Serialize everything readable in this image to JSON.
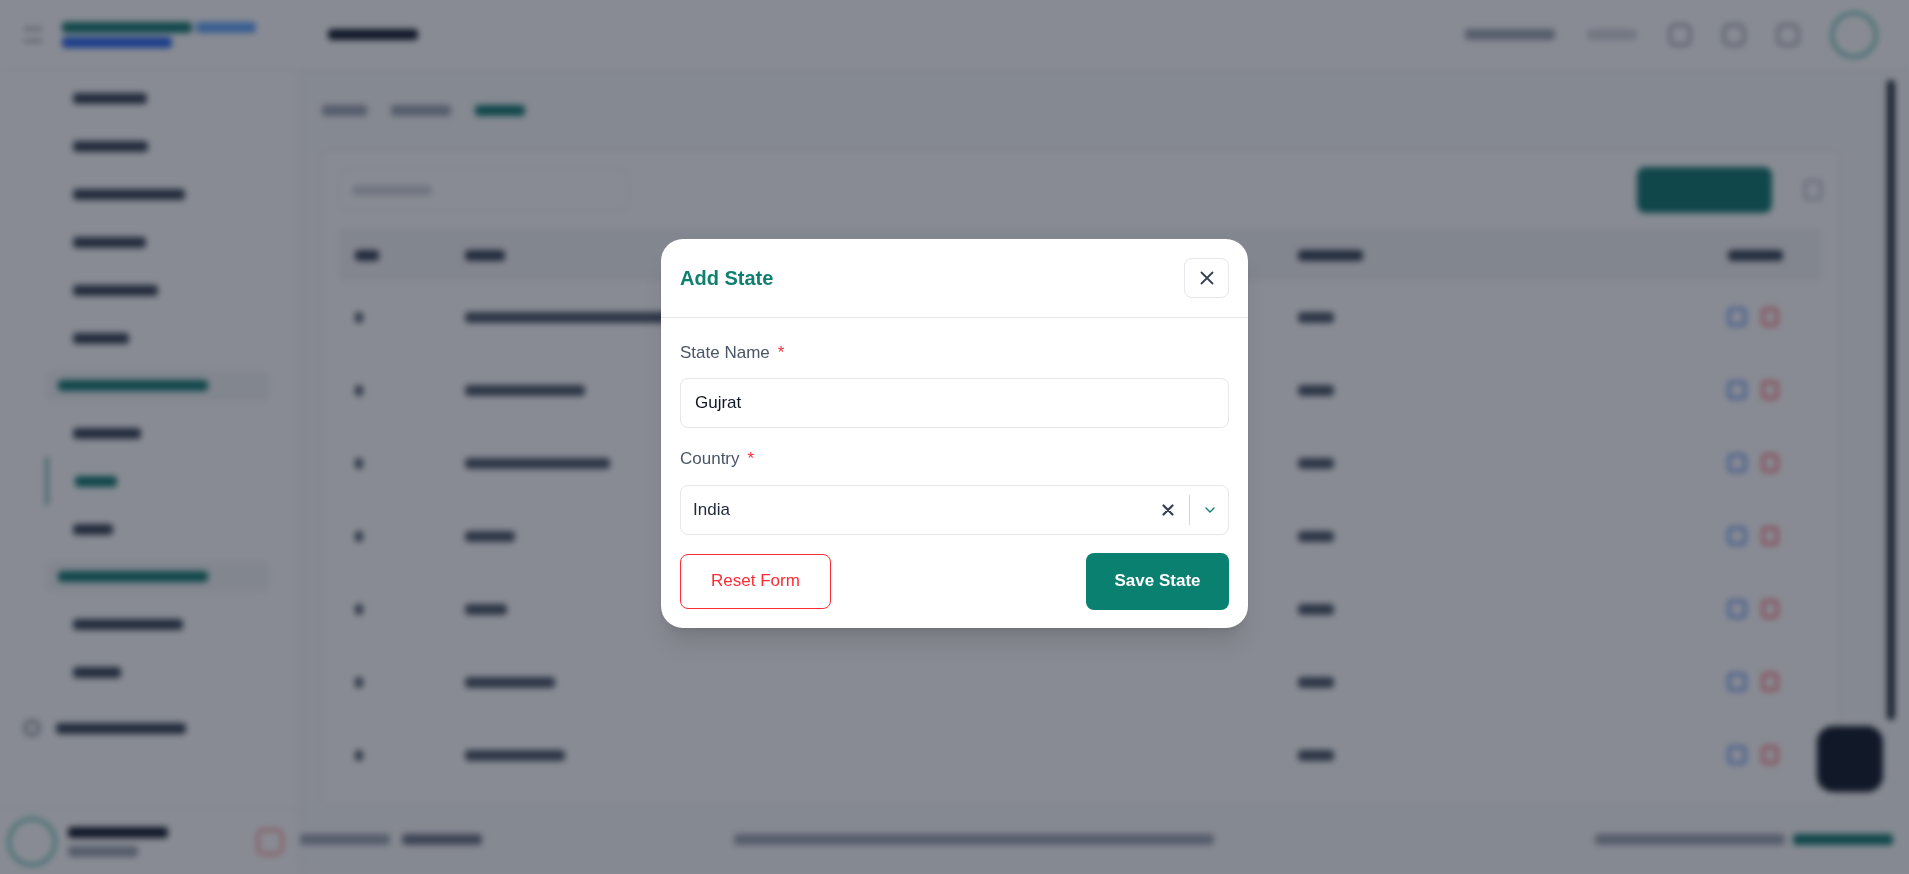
{
  "dialog": {
    "title": "Add State",
    "fields": [
      {
        "kind": "text",
        "label": "State Name",
        "required_mark": "*",
        "value": "Gujrat"
      },
      {
        "kind": "select",
        "label": "Country",
        "required_mark": "*",
        "value": "India"
      }
    ],
    "reset_button": "Reset Form",
    "save_button": "Save State"
  }
}
